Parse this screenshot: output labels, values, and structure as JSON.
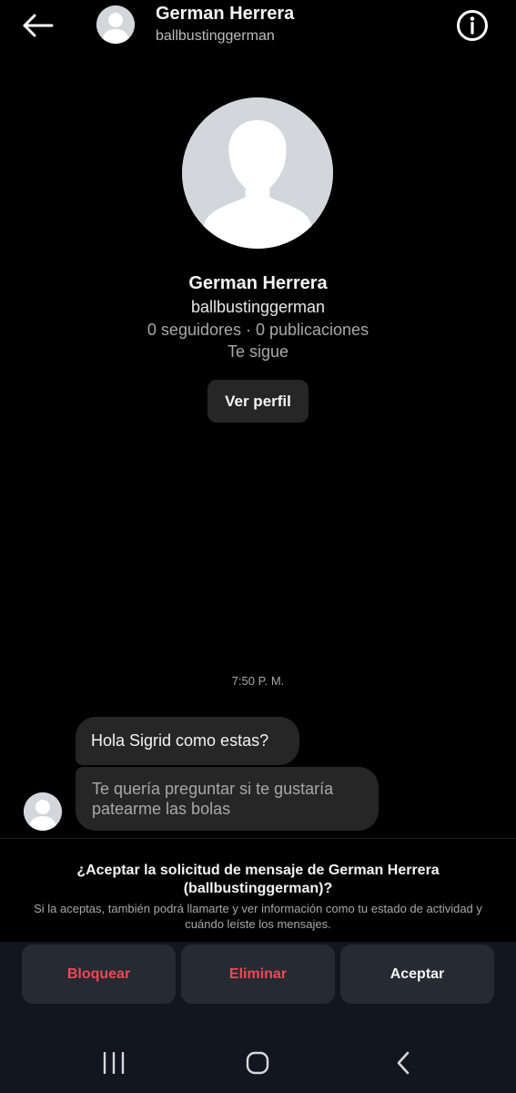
{
  "header": {
    "back_icon": "arrow-left-icon",
    "name": "German Herrera",
    "username": "ballbustinggerman",
    "info_icon": "info-circle-icon"
  },
  "profile": {
    "name": "German Herrera",
    "username": "ballbustinggerman",
    "stats": "0 seguidores · 0 publicaciones",
    "follow_status": "Te sigue",
    "view_profile_label": "Ver perfil"
  },
  "conversation": {
    "timestamp": "7:50 P. M.",
    "messages": [
      {
        "text": "Hola Sigrid como estas?"
      },
      {
        "text": "Te quería preguntar si te gustaría patearme las bolas"
      }
    ]
  },
  "request": {
    "title": "¿Aceptar la solicitud de mensaje de German Herrera (ballbustinggerman)?",
    "description": "Si la aceptas, también podrá llamarte y ver información como tu estado de actividad y cuándo leíste los mensajes.",
    "actions": {
      "block": "Bloquear",
      "delete": "Eliminar",
      "accept": "Aceptar"
    }
  },
  "colors": {
    "background": "#000000",
    "bubble": "#262626",
    "danger": "#ed4956",
    "action_panel": "#121621"
  },
  "nav_bar": {
    "icons": [
      "recents-icon",
      "home-icon",
      "back-chevron-icon"
    ]
  }
}
